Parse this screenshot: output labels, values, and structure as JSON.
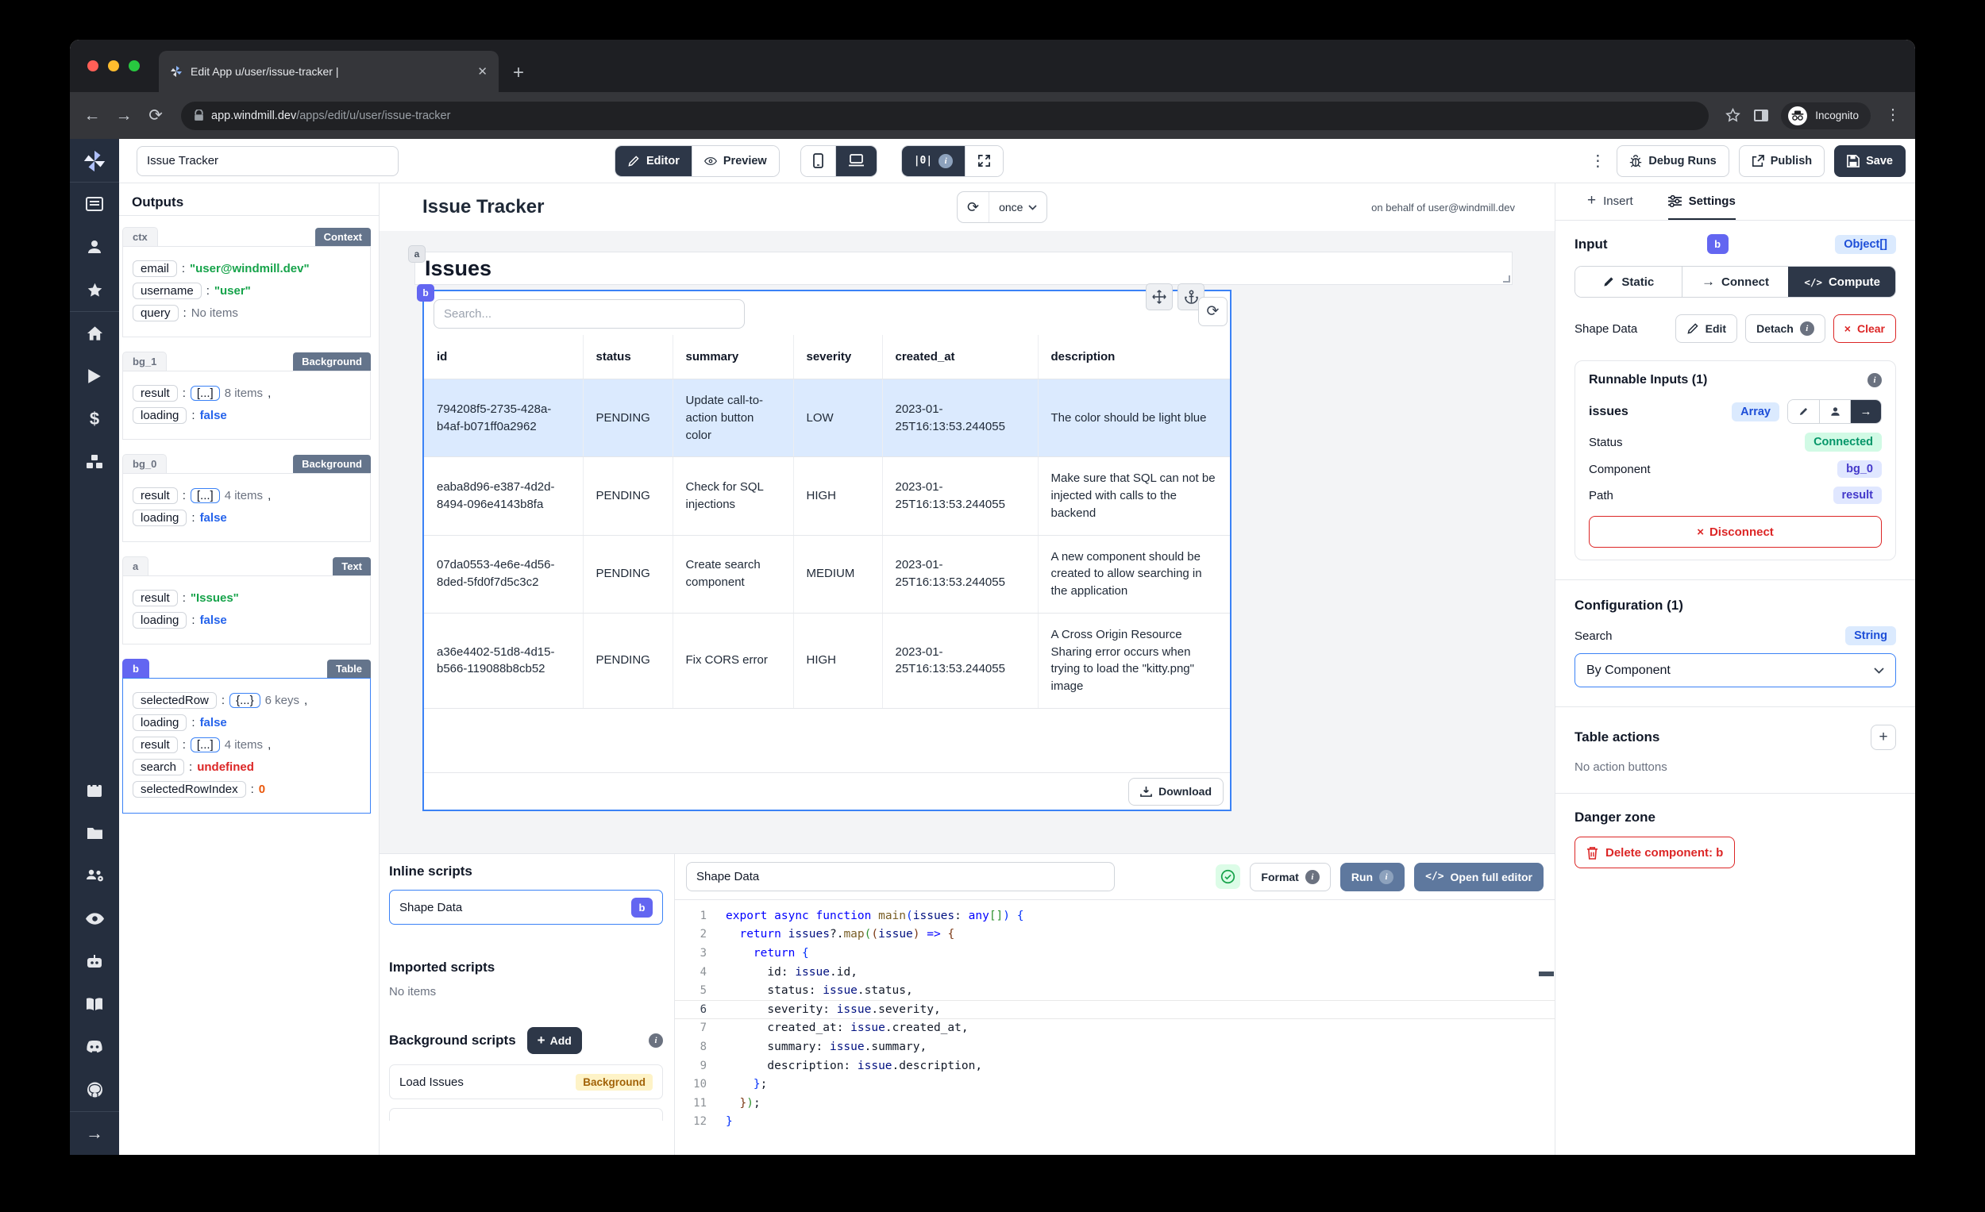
{
  "colors": {
    "indigo": "#6366f1",
    "blue": "#3b82f6",
    "dark_button": "#2d3748",
    "slate_button": "#5e789e",
    "green_text": "#16a34a",
    "blue_text": "#2563eb",
    "red_text": "#dc2626",
    "orange_text": "#ea580c",
    "selected_row_bg": "#dbeafe",
    "yellow_badge_bg": "#fef3c7"
  },
  "browser": {
    "tab_title": "Edit App u/user/issue-tracker |",
    "url_domain": "app.windmill.dev",
    "url_path": "/apps/edit/u/user/issue-tracker",
    "incognito_label": "Incognito"
  },
  "topbar": {
    "app_name": "Issue Tracker",
    "editor": "Editor",
    "preview": "Preview",
    "align_toggle": "|0|",
    "debug_runs": "Debug Runs",
    "publish": "Publish",
    "save": "Save"
  },
  "outputs": {
    "title": "Outputs",
    "ctx": {
      "id": "ctx",
      "badge": "Context",
      "email_key": "email",
      "email_val": "\"user@windmill.dev\"",
      "username_key": "username",
      "username_val": "\"user\"",
      "query_key": "query",
      "query_val": "No items"
    },
    "bg_1": {
      "id": "bg_1",
      "badge": "Background",
      "result_key": "result",
      "result_pill": "[...]",
      "result_count": "8 items",
      "comma": ",",
      "loading_key": "loading",
      "loading_val": "false"
    },
    "bg_0": {
      "id": "bg_0",
      "badge": "Background",
      "result_key": "result",
      "result_pill": "[...]",
      "result_count": "4 items",
      "comma": ",",
      "loading_key": "loading",
      "loading_val": "false"
    },
    "a": {
      "id": "a",
      "badge": "Text",
      "result_key": "result",
      "result_val": "\"Issues\"",
      "loading_key": "loading",
      "loading_val": "false"
    },
    "b": {
      "id": "b",
      "badge": "Table",
      "selectedRow_key": "selectedRow",
      "selectedRow_pill": "{...}",
      "selectedRow_count": "6 keys",
      "comma": ",",
      "loading_key": "loading",
      "loading_val": "false",
      "result_key": "result",
      "result_pill": "[...]",
      "result_count": "4 items",
      "search_key": "search",
      "search_val": "undefined",
      "selectedRowIndex_key": "selectedRowIndex",
      "selectedRowIndex_val": "0"
    }
  },
  "canvas": {
    "header": {
      "title": "Issue Tracker",
      "schedule": "once",
      "on_behalf": "on behalf of user@windmill.dev"
    },
    "text_component": {
      "badge": "a",
      "text": "Issues"
    },
    "table": {
      "badge": "b",
      "search_placeholder": "Search...",
      "columns": [
        "id",
        "status",
        "summary",
        "severity",
        "created_at",
        "description"
      ],
      "rows": [
        {
          "id": "794208f5-2735-428a-b4af-b071ff0a2962",
          "status": "PENDING",
          "summary": "Update call-to-action button color",
          "severity": "LOW",
          "created_at": "2023-01-25T16:13:53.244055",
          "description": "The color should be light blue"
        },
        {
          "id": "eaba8d96-e387-4d2d-8494-096e4143b8fa",
          "status": "PENDING",
          "summary": "Check for SQL injections",
          "severity": "HIGH",
          "created_at": "2023-01-25T16:13:53.244055",
          "description": "Make sure that SQL can not be injected with calls to the backend"
        },
        {
          "id": "07da0553-4e6e-4d56-8ded-5fd0f7d5c3c2",
          "status": "PENDING",
          "summary": "Create search component",
          "severity": "MEDIUM",
          "created_at": "2023-01-25T16:13:53.244055",
          "description": "A new component should be created to allow searching in the application"
        },
        {
          "id": "a36e4402-51d8-4d15-b566-119088b8cb52",
          "status": "PENDING",
          "summary": "Fix CORS error",
          "severity": "HIGH",
          "created_at": "2023-01-25T16:13:53.244055",
          "description": "A Cross Origin Resource Sharing error occurs when trying to load the \"kitty.png\" image"
        }
      ],
      "download": "Download"
    }
  },
  "inline_scripts": {
    "title": "Inline scripts",
    "shape_data": {
      "label": "Shape Data",
      "badge": "b"
    },
    "imported_title": "Imported scripts",
    "imported_empty": "No items",
    "background_title": "Background scripts",
    "add_label": "Add",
    "load_issues": {
      "label": "Load Issues",
      "badge": "Background"
    }
  },
  "editor": {
    "name": "Shape Data",
    "format": "Format",
    "run": "Run",
    "open_full": "Open full editor",
    "active_line": 6,
    "lines": [
      "export async function main(issues: any[]) {",
      "  return issues?.map((issue) => {",
      "    return {",
      "      id: issue.id,",
      "      status: issue.status,",
      "      severity: issue.severity,",
      "      created_at: issue.created_at,",
      "      summary: issue.summary,",
      "      description: issue.description,",
      "    };",
      "  });",
      "}"
    ]
  },
  "settings": {
    "insert_tab": "Insert",
    "settings_tab": "Settings",
    "input_label": "Input",
    "component_badge": "b",
    "input_type": "Object[]",
    "mode_static": "Static",
    "mode_connect": "Connect",
    "mode_compute": "Compute",
    "shape_data": "Shape Data",
    "edit": "Edit",
    "detach": "Detach",
    "clear": "Clear",
    "runnable": {
      "title": "Runnable Inputs (1)",
      "name": "issues",
      "type": "Array",
      "status_label": "Status",
      "status_value": "Connected",
      "component_label": "Component",
      "component_value": "bg_0",
      "path_label": "Path",
      "path_value": "result",
      "disconnect": "Disconnect"
    },
    "configuration": {
      "title": "Configuration (1)",
      "search_label": "Search",
      "search_type": "String",
      "select_value": "By Component"
    },
    "table_actions": {
      "title": "Table actions",
      "empty": "No action buttons"
    },
    "danger": {
      "title": "Danger zone",
      "delete_label": "Delete component: b"
    }
  }
}
